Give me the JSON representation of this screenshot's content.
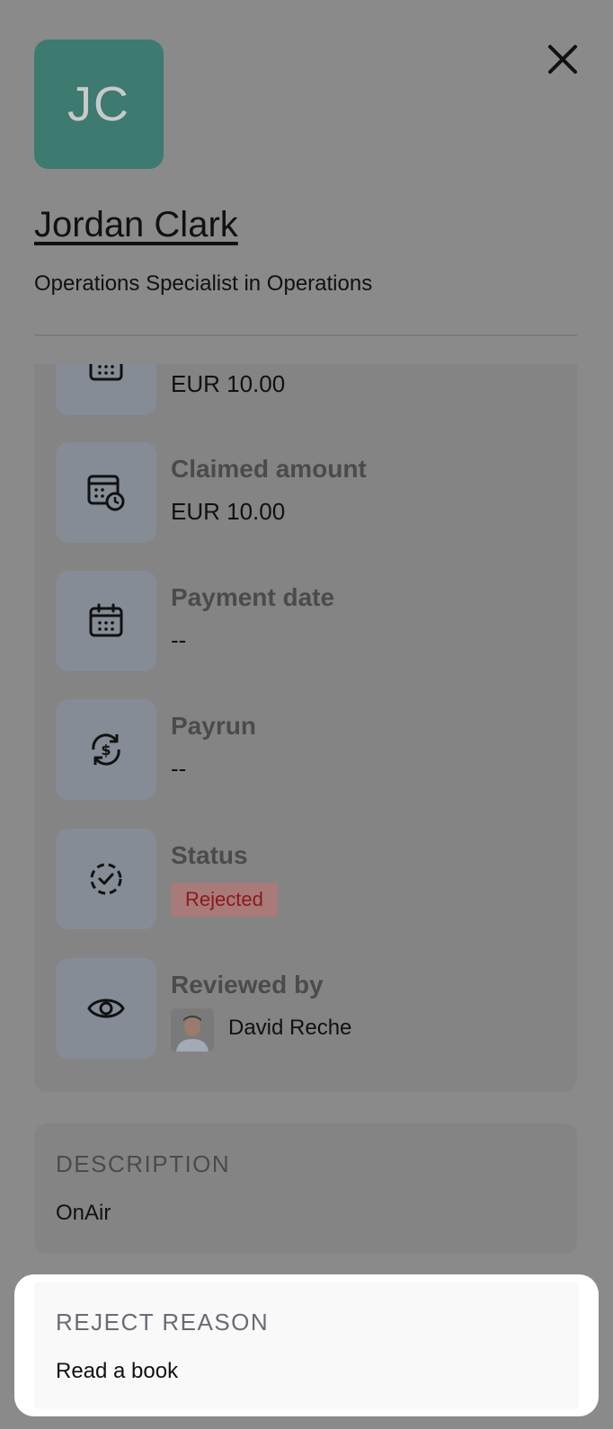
{
  "profile": {
    "initials": "JC",
    "name": "Jordan Clark",
    "role": "Operations Specialist in Operations"
  },
  "details": {
    "partial_value": "EUR 10.00",
    "claimed_amount": {
      "label": "Claimed amount",
      "value": "EUR 10.00"
    },
    "payment_date": {
      "label": "Payment date",
      "value": "--"
    },
    "payrun": {
      "label": "Payrun",
      "value": "--"
    },
    "status": {
      "label": "Status",
      "value": "Rejected"
    },
    "reviewed_by": {
      "label": "Reviewed by",
      "value": "David Reche"
    }
  },
  "description": {
    "title": "DESCRIPTION",
    "text": "OnAir"
  },
  "reject_reason": {
    "title": "REJECT REASON",
    "text": "Read a book"
  },
  "colors": {
    "avatar_bg": "#3d7a6f",
    "status_badge_bg": "#a97a7a",
    "status_badge_text": "#8a1a1a",
    "overlay": "#8a8a8a"
  }
}
